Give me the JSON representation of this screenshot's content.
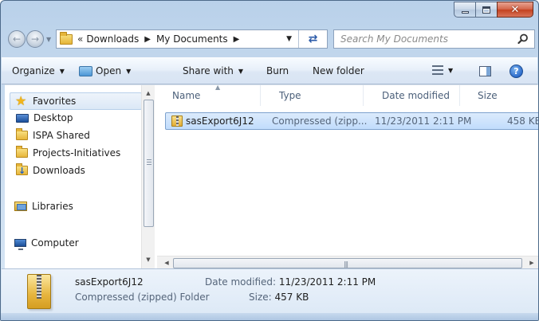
{
  "navigation": {
    "back_arrow": "←",
    "forward_arrow": "→",
    "breadcrumb_chevron": "«",
    "breadcrumbs": [
      "Downloads",
      "My Documents"
    ],
    "search_placeholder": "Search My Documents"
  },
  "toolbar": {
    "organize": "Organize",
    "open": "Open",
    "share_with": "Share with",
    "burn": "Burn",
    "new_folder": "New folder",
    "help": "?"
  },
  "nav_pane": {
    "favorites": "Favorites",
    "items": [
      "Desktop",
      "ISPA Shared",
      "Projects-Initiatives",
      "Downloads"
    ],
    "libraries": "Libraries",
    "computer": "Computer"
  },
  "file_list": {
    "columns": [
      "Name",
      "Type",
      "Date modified",
      "Size"
    ],
    "rows": [
      {
        "name": "sasExport6J12",
        "type": "Compressed (zipp...",
        "date": "11/23/2011 2:11 PM",
        "size": "458 KB"
      }
    ]
  },
  "details": {
    "name": "sasExport6J12",
    "type": "Compressed (zipped) Folder",
    "date_label": "Date modified:",
    "date_value": "11/23/2011 2:11 PM",
    "size_label": "Size:",
    "size_value": "457 KB"
  },
  "colors": {
    "window_frame": "#b9d1ea",
    "selection": "#c1dcfc",
    "close_button": "#c3421f"
  }
}
